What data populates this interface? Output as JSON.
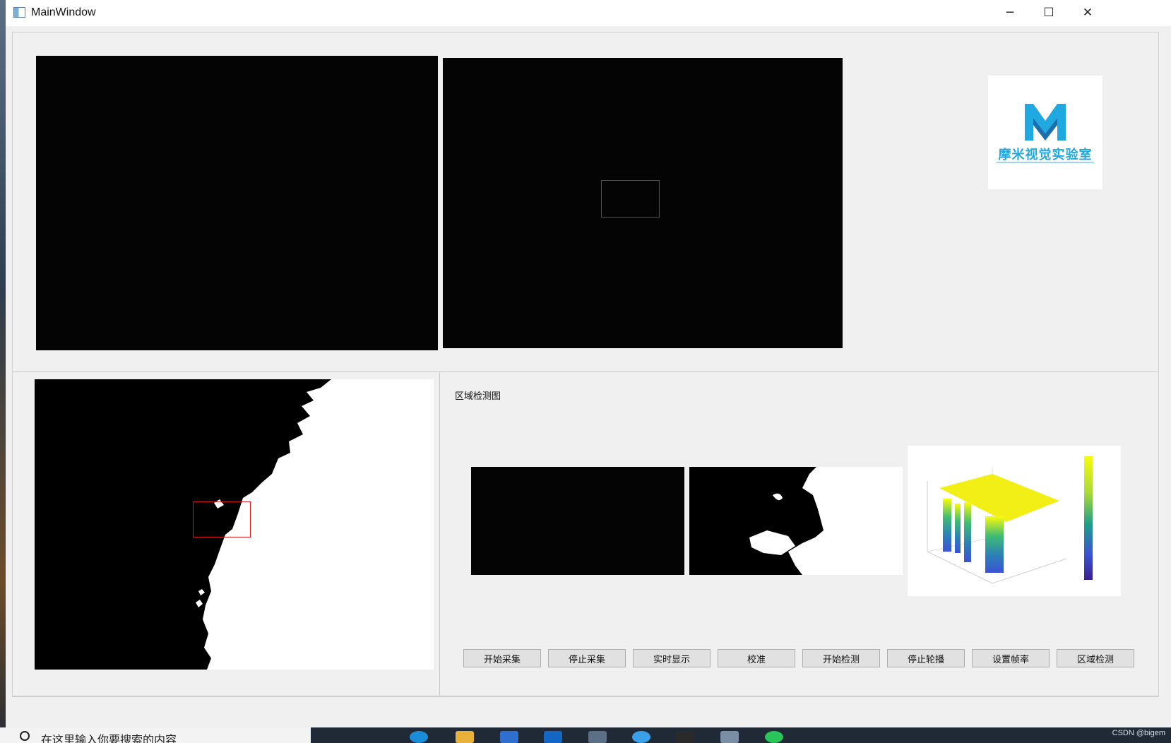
{
  "window": {
    "title": "MainWindow"
  },
  "controls": {
    "minimize": "─",
    "maximize": "☐",
    "close": "✕"
  },
  "logo": {
    "text": "摩米视觉实验室",
    "accent": "#20a8e0"
  },
  "detection_group": {
    "title": "区域检测图"
  },
  "buttons": [
    "开始采集",
    "停止采集",
    "实时显示",
    "校准",
    "开始检测",
    "停止轮播",
    "设置帧率",
    "区域检测"
  ],
  "surface_plot": {
    "colorbar_colors": [
      "#f9fb0e",
      "#a8d93a",
      "#3fbc73",
      "#1f9e89",
      "#2c7fb8",
      "#3b52d4",
      "#3c1f8f"
    ]
  },
  "taskbar": {
    "search_placeholder": "在这里输入你要搜索的内容",
    "watermark": "CSDN @bigem"
  }
}
